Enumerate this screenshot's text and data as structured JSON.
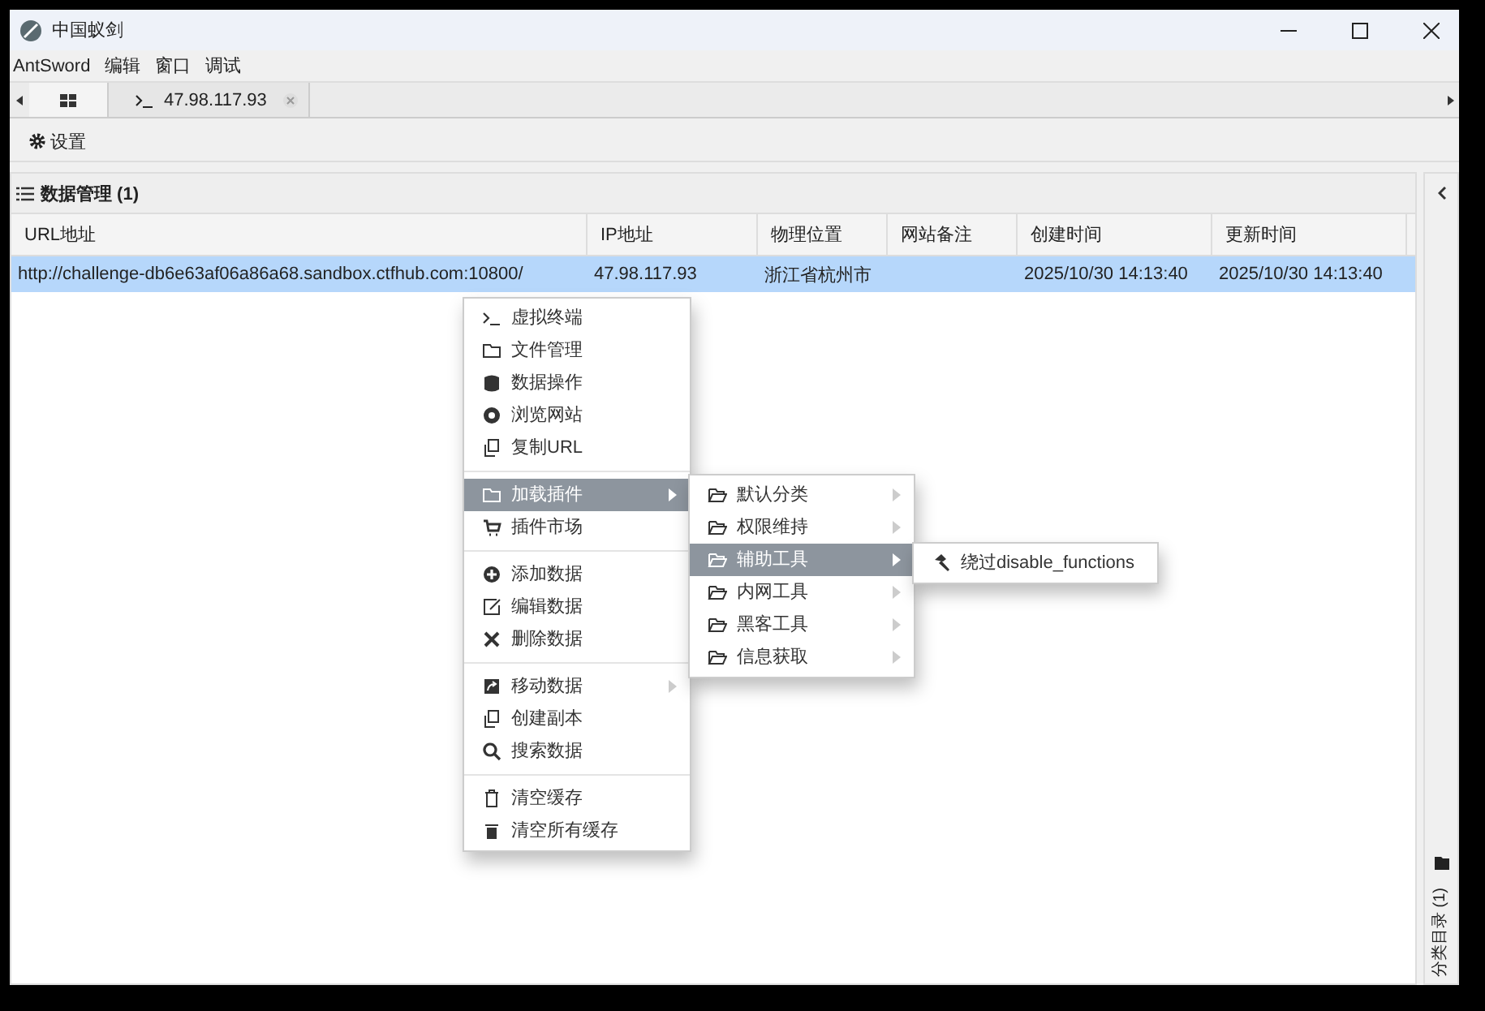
{
  "window": {
    "title": "中国蚁剑"
  },
  "menu_bar": [
    "AntSword",
    "编辑",
    "窗口",
    "调试"
  ],
  "tabs": [
    {
      "selected": true
    },
    {
      "label": "47.98.117.93",
      "selected": false,
      "closable": true
    }
  ],
  "toolbar": {
    "button": "设置"
  },
  "panel": {
    "title": "数据管理 (1)"
  },
  "table": {
    "columns": [
      "URL地址",
      "IP地址",
      "物理位置",
      "网站备注",
      "创建时间",
      "更新时间"
    ],
    "rows": [
      {
        "selected": true,
        "cells": [
          "http://challenge-db6e63af06a86a68.sandbox.ctfhub.com:10800/",
          "47.98.117.93",
          "浙江省杭州市",
          "",
          "2025/10/30 14:13:40",
          "2025/10/30 14:13:40"
        ]
      }
    ]
  },
  "context_menu": {
    "groups": [
      [
        {
          "label": "虚拟终端",
          "selected": false,
          "submenu": false
        },
        {
          "label": "文件管理",
          "selected": false,
          "submenu": false
        },
        {
          "label": "数据操作",
          "selected": false,
          "submenu": false
        },
        {
          "label": "浏览网站",
          "selected": false,
          "submenu": false
        },
        {
          "label": "复制URL",
          "selected": false,
          "submenu": false
        }
      ],
      [
        {
          "label": "加载插件",
          "selected": true,
          "submenu": true
        },
        {
          "label": "插件市场",
          "selected": false,
          "submenu": false
        }
      ],
      [
        {
          "label": "添加数据",
          "selected": false,
          "submenu": false
        },
        {
          "label": "编辑数据",
          "selected": false,
          "submenu": false
        },
        {
          "label": "删除数据",
          "selected": false,
          "submenu": false
        }
      ],
      [
        {
          "label": "移动数据",
          "selected": false,
          "submenu": true
        },
        {
          "label": "创建副本",
          "selected": false,
          "submenu": false
        },
        {
          "label": "搜索数据",
          "selected": false,
          "submenu": false
        }
      ],
      [
        {
          "label": "清空缓存",
          "selected": false,
          "submenu": false
        },
        {
          "label": "清空所有缓存",
          "selected": false,
          "submenu": false
        }
      ]
    ]
  },
  "plugin_menu": [
    {
      "label": "默认分类",
      "selected": false,
      "submenu": true
    },
    {
      "label": "权限维持",
      "selected": false,
      "submenu": true
    },
    {
      "label": "辅助工具",
      "selected": true,
      "submenu": true
    },
    {
      "label": "内网工具",
      "selected": false,
      "submenu": true
    },
    {
      "label": "黑客工具",
      "selected": false,
      "submenu": true
    },
    {
      "label": "信息获取",
      "selected": false,
      "submenu": true
    }
  ],
  "tool_menu": [
    {
      "label": "绕过disable_functions",
      "selected": false
    }
  ],
  "sidebar": {
    "label": "分类目录 (1)"
  }
}
